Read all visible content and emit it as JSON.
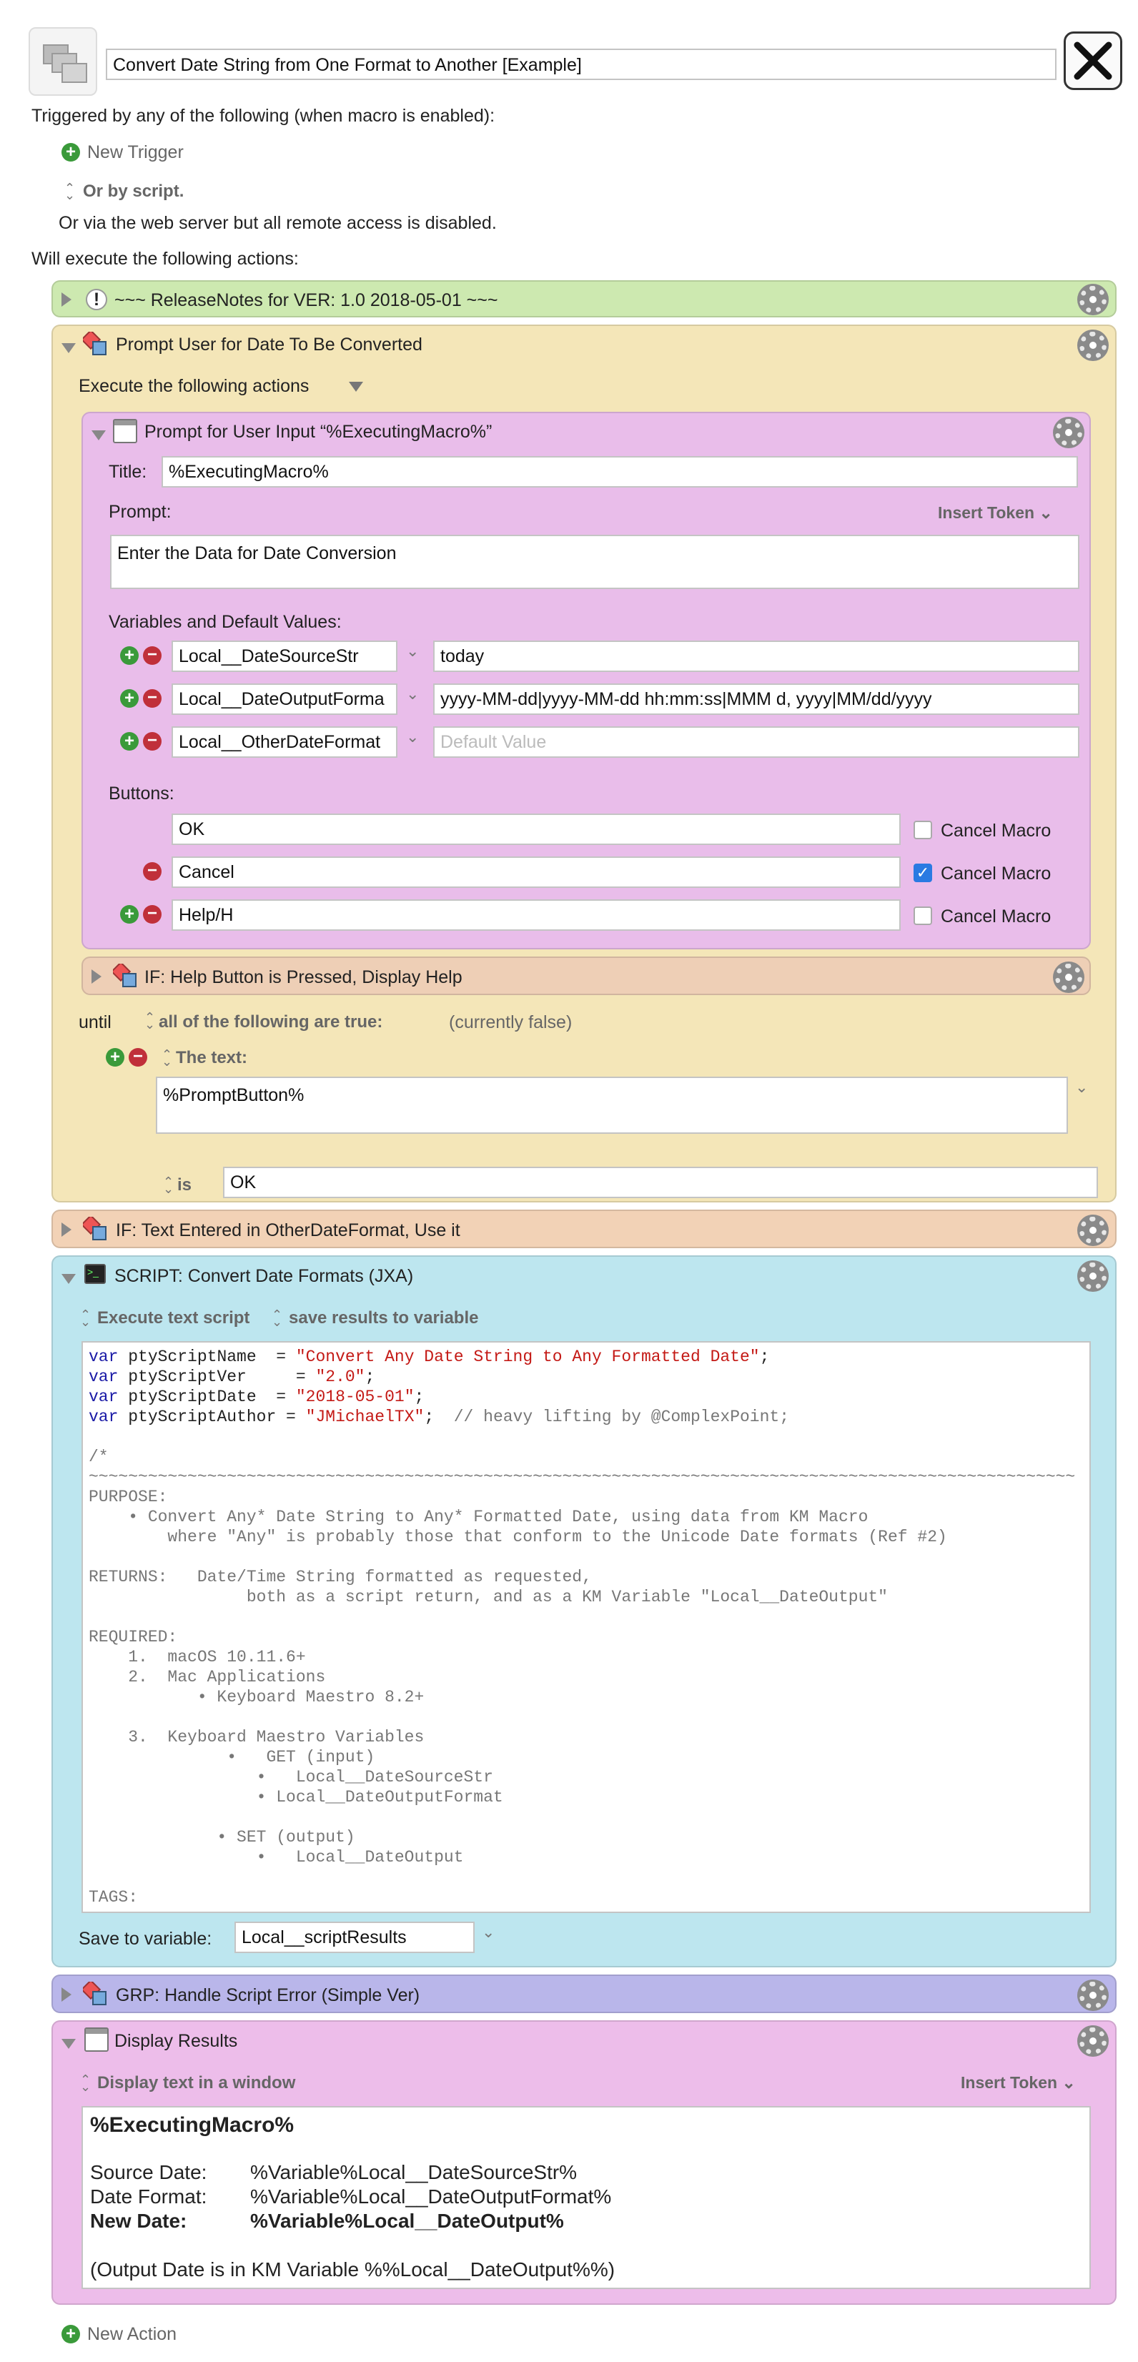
{
  "macro": {
    "title": "Convert Date String from One Format to Another [Example]"
  },
  "triggers": {
    "heading": "Triggered by any of the following (when macro is enabled):",
    "new_trigger": "New Trigger",
    "or_script": "Or by script.",
    "web_server": "Or via the web server but all remote access is disabled."
  },
  "actions_heading": "Will execute the following actions:",
  "release_notes": {
    "label": "~~~ ReleaseNotes for  VER: 1.0    2018-05-01 ~~~",
    "color": "#cde9b0"
  },
  "prompt_group": {
    "label": "Prompt User for Date To Be Converted",
    "execute_label": "Execute the following actions",
    "color": "#f4e6b8"
  },
  "prompt_input": {
    "label": "Prompt for User Input “%ExecutingMacro%”",
    "title_label": "Title:",
    "title_value": "%ExecutingMacro%",
    "prompt_label": "Prompt:",
    "insert_token": "Insert Token",
    "prompt_value": "Enter the Data for Date Conversion",
    "vars_label": "Variables and Default Values:",
    "vars": [
      {
        "name": "Local__DateSourceStr",
        "value": "today",
        "placeholder": ""
      },
      {
        "name": "Local__DateOutputForma",
        "value": "yyyy-MM-dd|yyyy-MM-dd hh:mm:ss|MMM d, yyyy|MM/dd/yyyy",
        "placeholder": ""
      },
      {
        "name": "Local__OtherDateFormat",
        "value": "",
        "placeholder": "Default Value"
      }
    ],
    "buttons_label": "Buttons:",
    "buttons": [
      {
        "value": "OK",
        "cancel": "Cancel Macro",
        "checked": false
      },
      {
        "value": "Cancel",
        "cancel": "Cancel Macro",
        "checked": true
      },
      {
        "value": "Help/H",
        "cancel": "Cancel Macro",
        "checked": false
      }
    ],
    "color": "#e9bdea"
  },
  "if_help": {
    "label": "IF:  Help Button is Pressed, Display Help",
    "color": "#eecfb6"
  },
  "until": {
    "label": "until",
    "condition": "all of the following are true:",
    "status": "(currently false)",
    "the_text": "The text:",
    "text_value": "%PromptButton%",
    "is_label": "is",
    "is_value": "OK"
  },
  "if_other": {
    "label": "IF:  Text Entered in OtherDateFormat, Use it",
    "color": "#f2d2b6"
  },
  "script": {
    "label": "SCRIPT:  Convert Date Formats (JXA)",
    "execute": "Execute text script",
    "save_mode": "save results to variable",
    "save_label": "Save to variable:",
    "save_value": "Local__scriptResults",
    "color": "#bde6ef",
    "lines": [
      [
        "kw:var",
        "t: ptyScriptName  = ",
        "s:\"Convert Any Date String to Any Formatted Date\"",
        "t:;"
      ],
      [
        "kw:var",
        "t: ptyScriptVer     = ",
        "s:\"2.0\"",
        "t:;"
      ],
      [
        "kw:var",
        "t: ptyScriptDate  = ",
        "s:\"2018-05-01\"",
        "t:;"
      ],
      [
        "kw:var",
        "t: ptyScriptAuthor = ",
        "s:\"JMichaelTX\"",
        "t:;  ",
        "c:// heavy lifting by @ComplexPoint;"
      ],
      [
        "t:"
      ],
      [
        "c:/*"
      ],
      [
        "c:~~~~~~~~~~~~~~~~~~~~~~~~~~~~~~~~~~~~~~~~~~~~~~~~~~~~~~~~~~~~~~~~~~~~~~~~~~~~~~~~~~~~~~~~~~~~~~~~~~~~"
      ],
      [
        "c:PURPOSE:"
      ],
      [
        "c:    • Convert Any* Date String to Any* Formatted Date, using data from KM Macro"
      ],
      [
        "c:        where \"Any\" is probably those that conform to the Unicode Date formats (Ref #2)"
      ],
      [
        "t:"
      ],
      [
        "c:RETURNS:   Date/Time String formatted as requested,"
      ],
      [
        "c:                both as a script return, and as a KM Variable \"Local__DateOutput\""
      ],
      [
        "t:"
      ],
      [
        "c:REQUIRED:"
      ],
      [
        "c:    1.  macOS 10.11.6+"
      ],
      [
        "c:    2.  Mac Applications"
      ],
      [
        "c:           • Keyboard Maestro 8.2+"
      ],
      [
        "t:"
      ],
      [
        "c:    3.  Keyboard Maestro Variables"
      ],
      [
        "c:              •   GET (input)"
      ],
      [
        "c:                 •   Local__DateSourceStr"
      ],
      [
        "c:                 • Local__DateOutputFormat"
      ],
      [
        "t:"
      ],
      [
        "c:             • SET (output)"
      ],
      [
        "c:                 •   Local__DateOutput"
      ],
      [
        "t:"
      ],
      [
        "c:TAGS:"
      ]
    ]
  },
  "grp": {
    "label": "GRP:  Handle Script Error (Simple Ver)",
    "color": "#b9b6ea"
  },
  "display": {
    "label": "Display Results",
    "mode": "Display text in a window",
    "insert_token": "Insert Token",
    "heading": "%ExecutingMacro%",
    "rows": [
      {
        "k": "Source Date:",
        "v": "%Variable%Local__DateSourceStr%"
      },
      {
        "k": "Date Format:",
        "v": "%Variable%Local__DateOutputFormat%"
      },
      {
        "k": "New Date:",
        "v": "%Variable%Local__DateOutput%"
      }
    ],
    "note": "(Output Date is in KM Variable %%Local__DateOutput%%)",
    "color": "#edbdea"
  },
  "new_action": "New Action"
}
